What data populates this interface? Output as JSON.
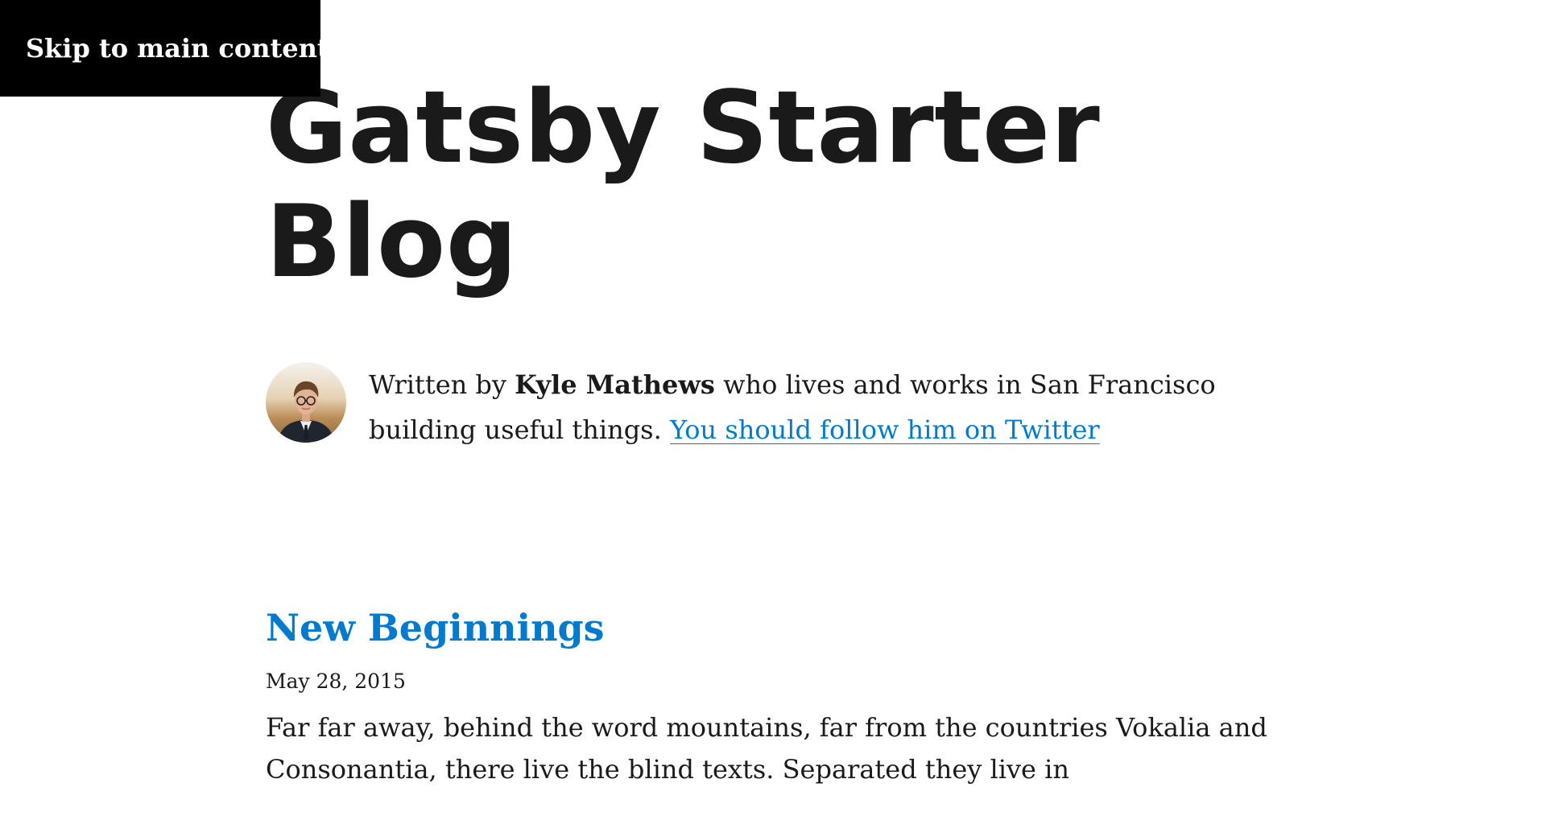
{
  "skip_link": {
    "label": "Skip to main content"
  },
  "header": {
    "title": "Gatsby Starter Blog"
  },
  "bio": {
    "prefix": "Written by ",
    "author": "Kyle Mathews",
    "suffix": " who lives and works in San Francisco building useful things. ",
    "link_text": "You should follow him on Twitter"
  },
  "posts": [
    {
      "title": "New Beginnings",
      "date": "May 28, 2015",
      "excerpt": "Far far away, behind the word mountains, far from the countries Vokalia and Consonantia, there live the blind texts. Separated they live in"
    }
  ],
  "colors": {
    "link": "#007acc",
    "text": "#1a1a1a",
    "skip_bg": "#000000"
  }
}
